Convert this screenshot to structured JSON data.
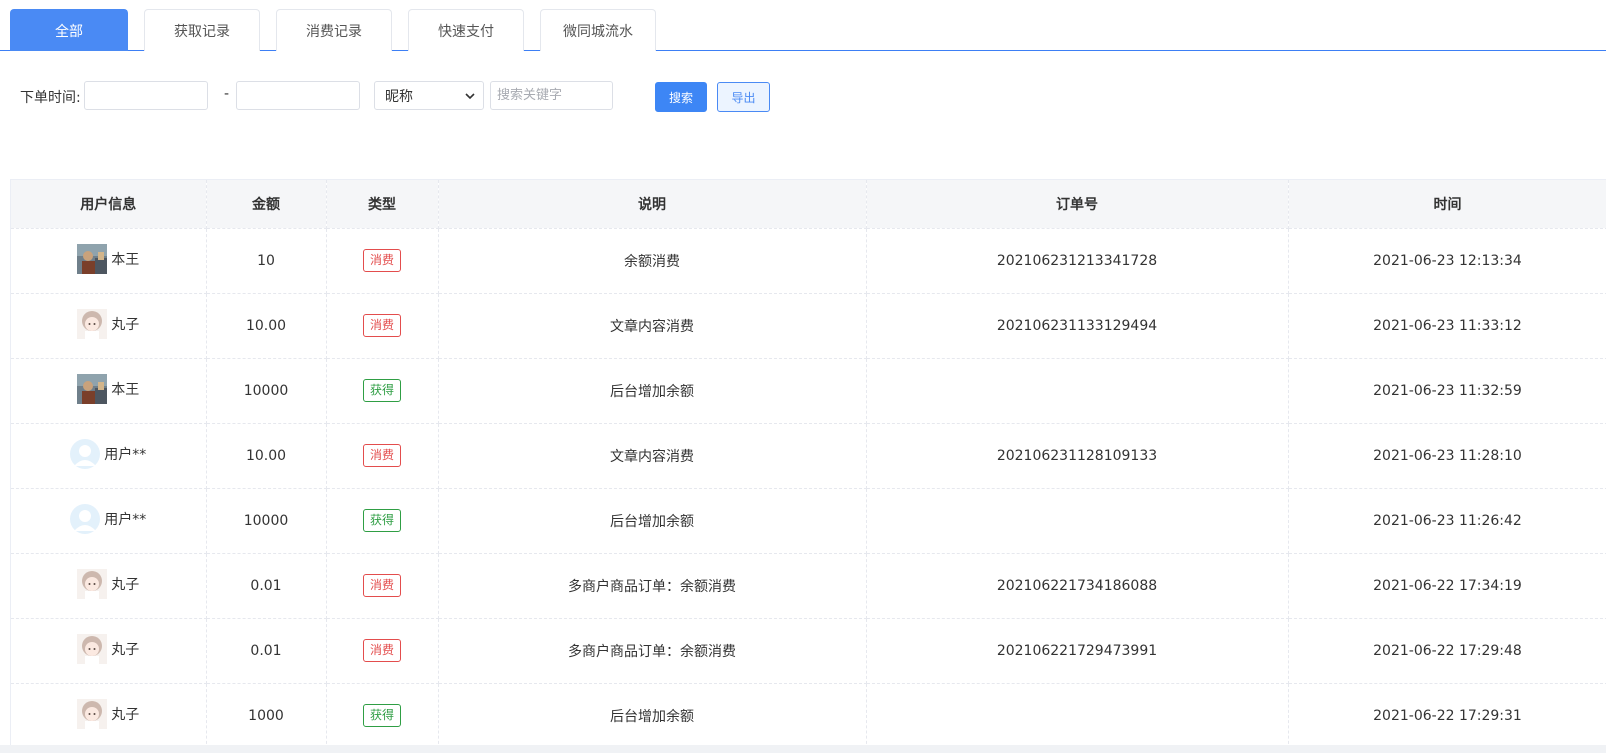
{
  "tabs": [
    {
      "label": "全部",
      "active": true
    },
    {
      "label": "获取记录",
      "active": false
    },
    {
      "label": "消费记录",
      "active": false
    },
    {
      "label": "快速支付",
      "active": false
    },
    {
      "label": "微同城流水",
      "active": false
    }
  ],
  "filter": {
    "order_time_label": "下单时间:",
    "start_date_value": "",
    "range_separator": "-",
    "end_date_value": "",
    "field_select_value": "昵称",
    "keyword_placeholder": "搜索关键字",
    "search_label": "搜索",
    "export_label": "导出"
  },
  "table": {
    "columns": [
      "用户信息",
      "金额",
      "类型",
      "说明",
      "订单号",
      "时间"
    ],
    "rows": [
      {
        "user": "本王",
        "avatar": "photo-avatar",
        "amount": "10",
        "type": "消费",
        "type_kind": "consume",
        "desc": "余额消费",
        "order_no": "202106231213341728",
        "time": "2021-06-23 12:13:34"
      },
      {
        "user": "丸子",
        "avatar": "anime-avatar",
        "amount": "10.00",
        "type": "消费",
        "type_kind": "consume",
        "desc": "文章内容消费",
        "order_no": "202106231133129494",
        "time": "2021-06-23 11:33:12"
      },
      {
        "user": "本王",
        "avatar": "photo-avatar",
        "amount": "10000",
        "type": "获得",
        "type_kind": "obtain",
        "desc": "后台增加余额",
        "order_no": "",
        "time": "2021-06-23 11:32:59"
      },
      {
        "user": "用户**",
        "avatar": "default-avatar",
        "amount": "10.00",
        "type": "消费",
        "type_kind": "consume",
        "desc": "文章内容消费",
        "order_no": "202106231128109133",
        "time": "2021-06-23 11:28:10"
      },
      {
        "user": "用户**",
        "avatar": "default-avatar",
        "amount": "10000",
        "type": "获得",
        "type_kind": "obtain",
        "desc": "后台增加余额",
        "order_no": "",
        "time": "2021-06-23 11:26:42"
      },
      {
        "user": "丸子",
        "avatar": "anime-avatar",
        "amount": "0.01",
        "type": "消费",
        "type_kind": "consume",
        "desc": "多商户商品订单：余额消费",
        "order_no": "202106221734186088",
        "time": "2021-06-22 17:34:19"
      },
      {
        "user": "丸子",
        "avatar": "anime-avatar",
        "amount": "0.01",
        "type": "消费",
        "type_kind": "consume",
        "desc": "多商户商品订单：余额消费",
        "order_no": "202106221729473991",
        "time": "2021-06-22 17:29:48"
      },
      {
        "user": "丸子",
        "avatar": "anime-avatar",
        "amount": "1000",
        "type": "获得",
        "type_kind": "obtain",
        "desc": "后台增加余额",
        "order_no": "",
        "time": "2021-06-22 17:29:31"
      }
    ]
  },
  "colors": {
    "accent": "#4a8af4",
    "consume": "#e34d4d",
    "obtain": "#2f9e44"
  }
}
